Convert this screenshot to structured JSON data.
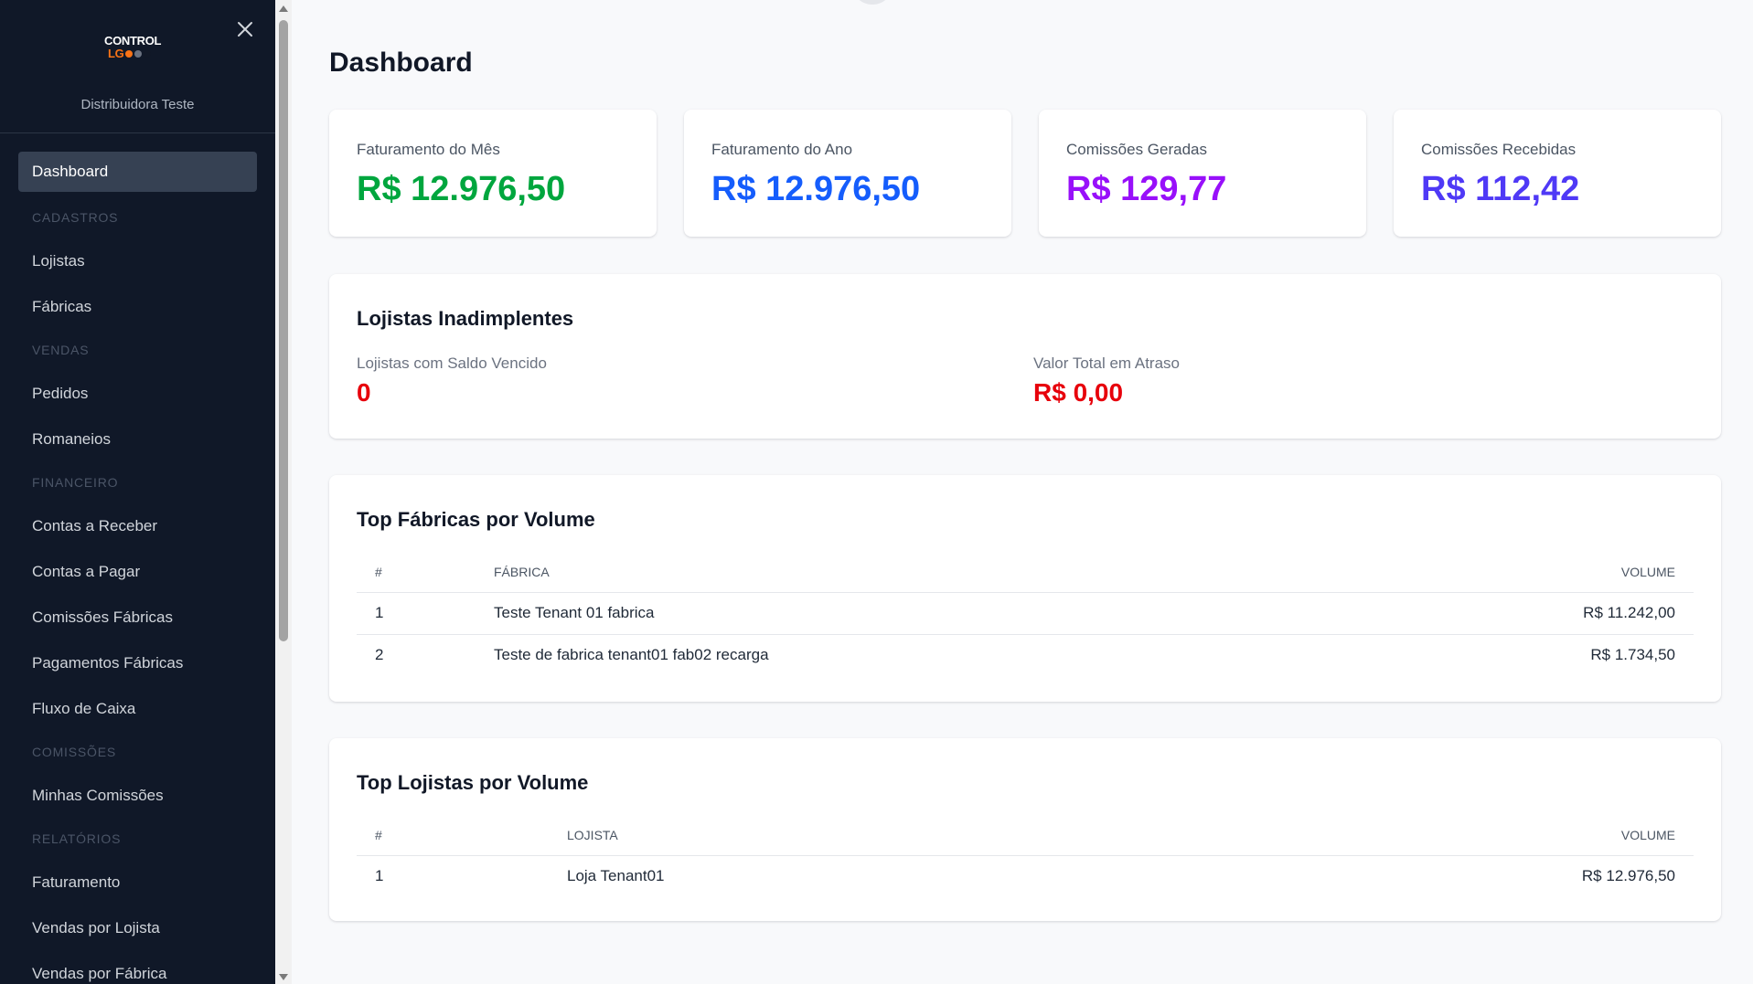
{
  "sidebar": {
    "logo_top": "CONTROL",
    "logo_bottom": "LG",
    "tenant_name": "Distribuidora Teste",
    "active_item": "Dashboard",
    "sections": [
      {
        "title": "CADASTROS",
        "items": [
          "Lojistas",
          "Fábricas"
        ]
      },
      {
        "title": "VENDAS",
        "items": [
          "Pedidos",
          "Romaneios"
        ]
      },
      {
        "title": "FINANCEIRO",
        "items": [
          "Contas a Receber",
          "Contas a Pagar",
          "Comissões Fábricas",
          "Pagamentos Fábricas",
          "Fluxo de Caixa"
        ]
      },
      {
        "title": "COMISSÕES",
        "items": [
          "Minhas Comissões"
        ]
      },
      {
        "title": "RELATÓRIOS",
        "items": [
          "Faturamento",
          "Vendas por Lojista",
          "Vendas por Fábrica"
        ]
      }
    ]
  },
  "page": {
    "title": "Dashboard"
  },
  "stats": [
    {
      "label": "Faturamento do Mês",
      "value": "R$ 12.976,50",
      "color": "#00a63e"
    },
    {
      "label": "Faturamento do Ano",
      "value": "R$ 12.976,50",
      "color": "#155dfc"
    },
    {
      "label": "Comissões Geradas",
      "value": "R$ 129,77",
      "color": "#9810fa"
    },
    {
      "label": "Comissões Recebidas",
      "value": "R$ 112,42",
      "color": "#4f39f6"
    }
  ],
  "overdue": {
    "title": "Lojistas Inadimplentes",
    "count_label": "Lojistas com Saldo Vencido",
    "count_value": "0",
    "total_label": "Valor Total em Atraso",
    "total_value": "R$ 0,00"
  },
  "top_factories": {
    "title": "Top Fábricas por Volume",
    "headers": [
      "#",
      "Fábrica",
      "Volume"
    ],
    "rows": [
      {
        "rank": "1",
        "name": "Teste Tenant 01 fabrica",
        "volume": "R$ 11.242,00"
      },
      {
        "rank": "2",
        "name": "Teste de fabrica tenant01 fab02 recarga",
        "volume": "R$ 1.734,50"
      }
    ]
  },
  "top_stores": {
    "title": "Top Lojistas por Volume",
    "headers": [
      "#",
      "Lojista",
      "Volume"
    ],
    "rows": [
      {
        "rank": "1",
        "name": "Loja Tenant01",
        "volume": "R$ 12.976,50"
      }
    ]
  },
  "icons": {
    "close": "close-icon",
    "scroll_up": "arrow-up-icon",
    "scroll_down": "arrow-down-icon"
  },
  "colors": {
    "sidebar_bg": "#101828",
    "active_bg": "#364153",
    "danger": "#e7000b",
    "logo_orange": "#f97316"
  }
}
